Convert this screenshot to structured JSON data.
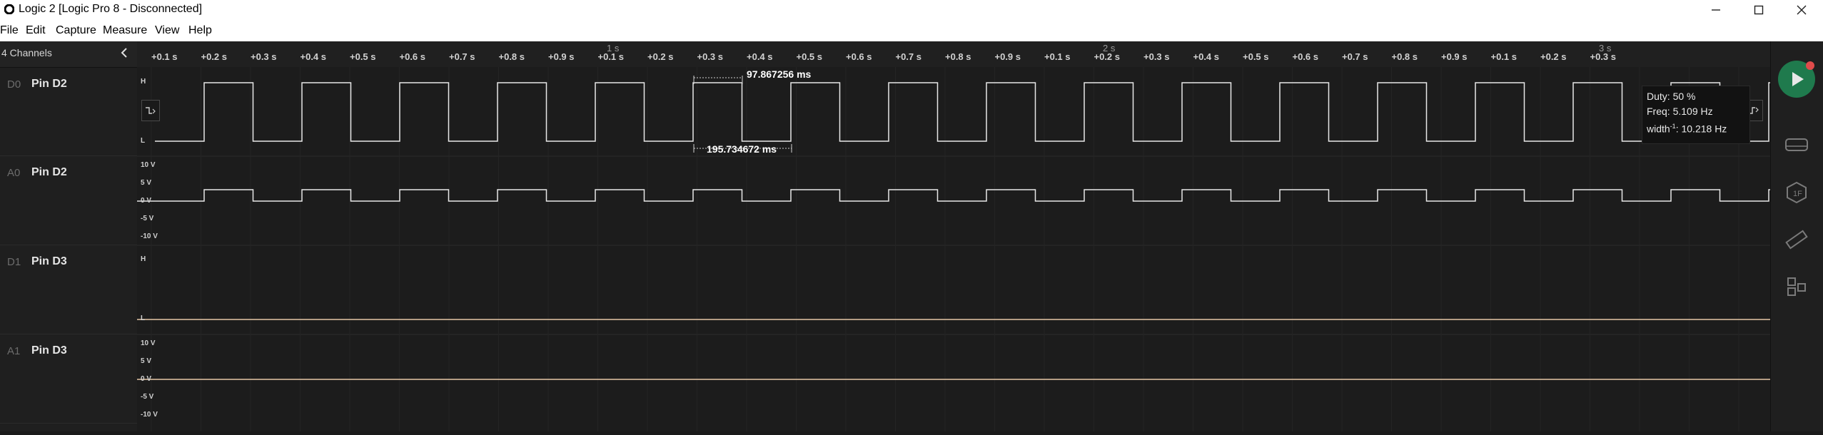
{
  "window": {
    "title": "Logic 2 [Logic Pro 8 - Disconnected]"
  },
  "menu": {
    "file": "File",
    "edit": "Edit",
    "capture": "Capture",
    "measure": "Measure",
    "view": "View",
    "help": "Help"
  },
  "channels_panel": {
    "count_label": "4 Channels"
  },
  "channels": [
    {
      "id": "D0",
      "name": "Pin D2"
    },
    {
      "id": "A0",
      "name": "Pin D2"
    },
    {
      "id": "D1",
      "name": "Pin D3"
    },
    {
      "id": "A1",
      "name": "Pin D3"
    }
  ],
  "timeline": {
    "seconds": [
      "1 s",
      "2 s",
      "3 s"
    ],
    "ticks": [
      "+0.1 s",
      "+0.2 s",
      "+0.3 s",
      "+0.4 s",
      "+0.5 s",
      "+0.6 s",
      "+0.7 s",
      "+0.8 s",
      "+0.9 s",
      "+0.1 s",
      "+0.2 s",
      "+0.3 s",
      "+0.4 s",
      "+0.5 s",
      "+0.6 s",
      "+0.7 s",
      "+0.8 s",
      "+0.9 s",
      "+0.1 s",
      "+0.2 s",
      "+0.3 s",
      "+0.4 s",
      "+0.5 s",
      "+0.6 s",
      "+0.7 s",
      "+0.8 s",
      "+0.9 s",
      "+0.1 s",
      "+0.2 s",
      "+0.3 s"
    ]
  },
  "digital_labels": {
    "high": "H",
    "low": "L"
  },
  "analog_labels": [
    "10 V",
    "5 V",
    "0 V",
    "-5 V",
    "-10 V"
  ],
  "measurements": {
    "pulse_width": "97.867256 ms",
    "period": "195.734672 ms"
  },
  "tooltip": {
    "duty": "Duty: 50 %",
    "freq": "Freq: 5.109 Hz",
    "width_prefix": "width",
    "width_sup": "-1",
    "width_value": ": 10.218 Hz"
  },
  "colors": {
    "digital_wave": "#e8e8e8",
    "flat_trace": "#e6c7a6",
    "run_button": "#1f7a4d",
    "run_dot": "#e04b4b"
  }
}
